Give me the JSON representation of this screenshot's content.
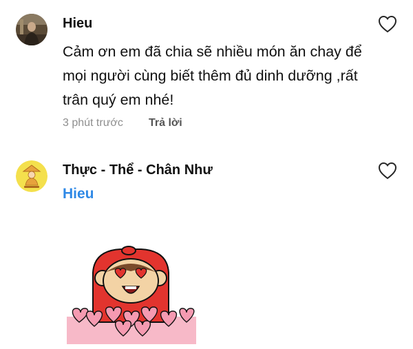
{
  "comments": [
    {
      "author": "Hieu",
      "text": "Cảm ơn em đã chia sẽ nhiều món ăn chay để mọi người cùng biết thêm đủ dinh dưỡng ,rất trân quý em nhé!",
      "time": "3 phút trước",
      "reply_label": "Trả lời",
      "avatar_icon": "profile-photo",
      "like_icon": "heart-outline-icon"
    },
    {
      "author": "Thực - Thể - Chân Như",
      "mention": "Hieu",
      "avatar_icon": "monk-logo",
      "avatar_color": "#f4e04d",
      "mention_color": "#2f89e6",
      "attachment": "monkey-hearts-sticker",
      "like_icon": "heart-outline-icon"
    }
  ]
}
